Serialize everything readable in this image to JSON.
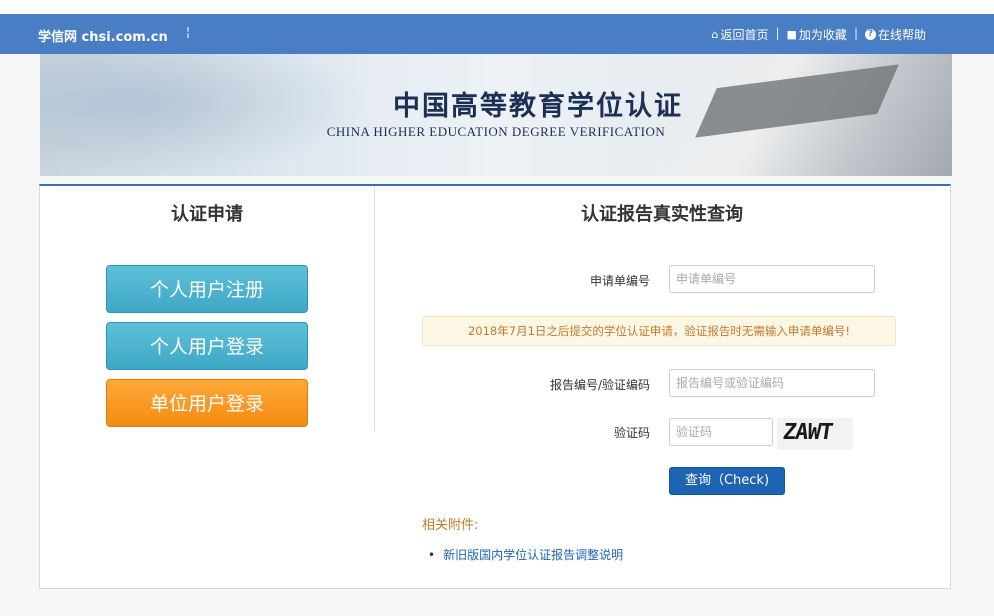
{
  "header": {
    "brand": "学信网 chsi.com.cn",
    "brand_sep": "¦",
    "links": [
      {
        "icon": "home-icon",
        "glyph": "⌂",
        "label": "返回首页"
      },
      {
        "icon": "bookmark-icon",
        "glyph": "■",
        "label": "加为收藏"
      },
      {
        "icon": "help-icon",
        "glyph": "?",
        "label": "在线帮助"
      }
    ],
    "divider": "|",
    "accent": "#4a7ec4"
  },
  "banner": {
    "title": "中国高等教育学位认证",
    "subtitle": "CHINA HIGHER EDUCATION DEGREE VERIFICATION"
  },
  "left": {
    "title": "认证申请",
    "buttons": [
      {
        "label": "个人用户注册",
        "color": "#4db4d0"
      },
      {
        "label": "个人用户登录",
        "color": "#4db4d0"
      },
      {
        "label": "单位用户登录",
        "color": "#f79a22"
      }
    ]
  },
  "right": {
    "title": "认证报告真实性查询",
    "application_no": {
      "label": "申请单编号",
      "placeholder": "申请单编号",
      "value": ""
    },
    "notice": "2018年7月1日之后提交的学位认证申请，验证报告时无需输入申请单编号!",
    "report_no": {
      "label": "报告编号/验证编码",
      "placeholder": "报告编号或验证编码",
      "value": ""
    },
    "captcha": {
      "label": "验证码",
      "placeholder": "验证码",
      "value": "",
      "image_text": "ZAWT"
    },
    "submit": "查询（Check)",
    "attachments_title": "相关附件:",
    "attachments": [
      {
        "bullet": "•",
        "label": "新旧版国内学位认证报告调整说明"
      }
    ]
  }
}
